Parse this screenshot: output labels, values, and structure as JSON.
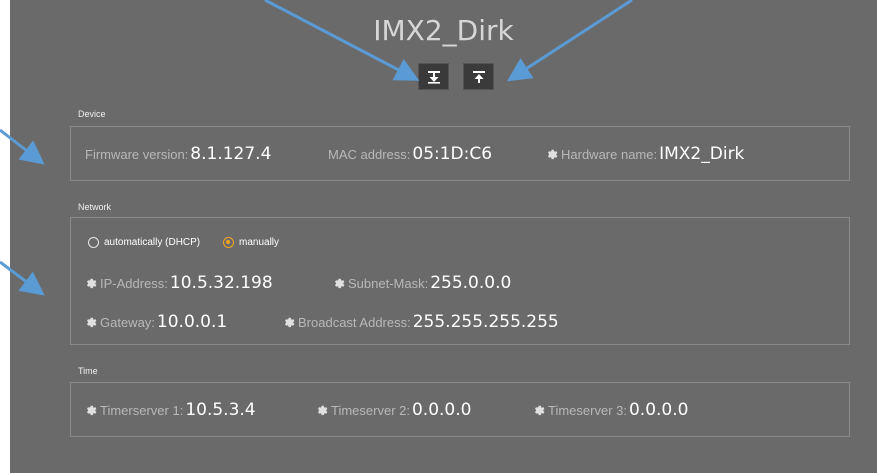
{
  "device_title": "IMX2_Dirk",
  "toolbar": {
    "download_icon": "download-icon",
    "upload_icon": "upload-icon"
  },
  "device": {
    "section_label": "Device",
    "firmware_label": "Firmware version:",
    "firmware_value": "8.1.127.4",
    "mac_label": "MAC address:",
    "mac_value": "05:1D:C6",
    "hardware_label": "Hardware name:",
    "hardware_value": "IMX2_Dirk"
  },
  "network": {
    "section_label": "Network",
    "dhcp_label": "automatically (DHCP)",
    "manual_label": "manually",
    "selected_mode": "manually",
    "ip_label": "IP-Address:",
    "ip_value": "10.5.32.198",
    "subnet_label": "Subnet-Mask:",
    "subnet_value": "255.0.0.0",
    "gateway_label": "Gateway:",
    "gateway_value": "10.0.0.1",
    "broadcast_label": "Broadcast Address:",
    "broadcast_value": "255.255.255.255"
  },
  "time": {
    "section_label": "Time",
    "ts1_label": "Timerserver 1:",
    "ts1_value": "10.5.3.4",
    "ts2_label": "Timeserver 2:",
    "ts2_value": "0.0.0.0",
    "ts3_label": "Timeserver 3:",
    "ts3_value": "0.0.0.0"
  },
  "colors": {
    "panel_bg": "#6a6a6a",
    "accent": "#f5a623",
    "annotation_arrow": "#5b9bd5"
  }
}
